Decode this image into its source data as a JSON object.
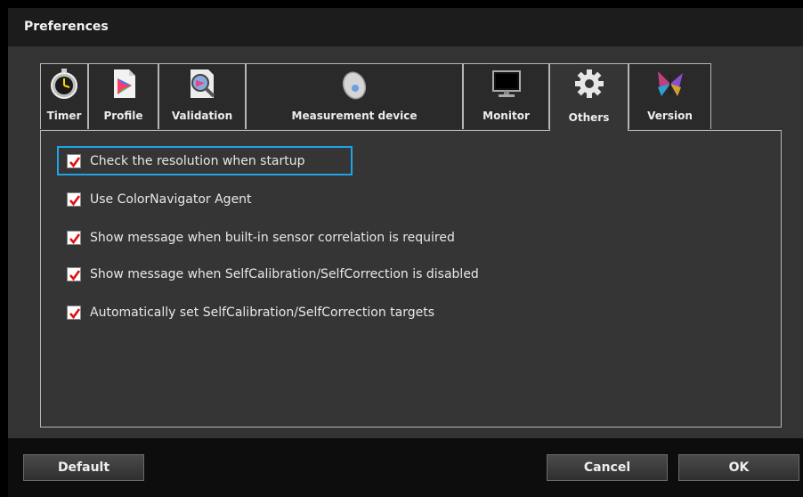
{
  "window": {
    "title": "Preferences"
  },
  "tabs": [
    {
      "id": "timer",
      "label": "Timer",
      "icon": "stopwatch-icon"
    },
    {
      "id": "profile",
      "label": "Profile",
      "icon": "profile-icon"
    },
    {
      "id": "validation",
      "label": "Validation",
      "icon": "validation-magnifier-icon"
    },
    {
      "id": "measurement",
      "label": "Measurement device",
      "icon": "mouse-sensor-icon"
    },
    {
      "id": "monitor",
      "label": "Monitor",
      "icon": "monitor-icon"
    },
    {
      "id": "others",
      "label": "Others",
      "icon": "gear-icon",
      "active": true
    },
    {
      "id": "version",
      "label": "Version",
      "icon": "butterfly-icon"
    }
  ],
  "options": [
    {
      "label": "Check the resolution when startup",
      "checked": true,
      "focused": true
    },
    {
      "label": "Use ColorNavigator Agent",
      "checked": true
    },
    {
      "label": "Show message when built-in sensor correlation is required",
      "checked": true
    },
    {
      "label": "Show message when SelfCalibration/SelfCorrection is disabled",
      "checked": true
    },
    {
      "label": "Automatically set SelfCalibration/SelfCorrection targets",
      "checked": true
    }
  ],
  "buttons": {
    "default": "Default",
    "cancel": "Cancel",
    "ok": "OK"
  },
  "colors": {
    "focus": "#1fa3e6",
    "check": "#e01010",
    "background": "#333333"
  }
}
